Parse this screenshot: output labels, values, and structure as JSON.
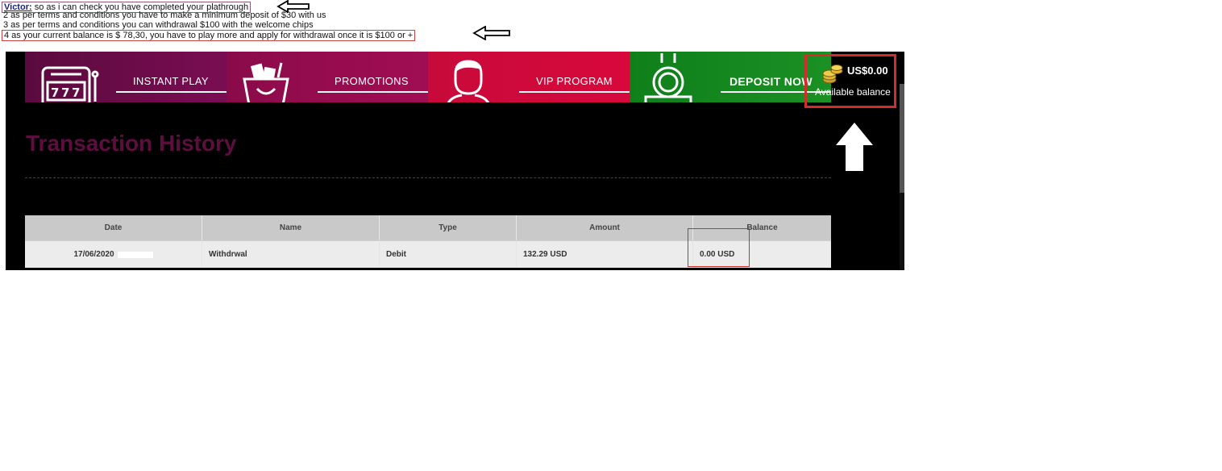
{
  "chat": {
    "speaker": "Victor:",
    "line1": " so as i can check you have completed your plathrough",
    "line2": "2 as per terms and conditions you have to make a minimum deposit of $30 with us",
    "line3": "3 as per terms and conditions you can withdrawal $100 with the welcome chips",
    "line4": "4 as your current balance is $ 78,30, you have to play more and apply for withdrawal once it is $100 or +"
  },
  "nav": {
    "items": [
      {
        "label": "INSTANT PLAY",
        "color": "#6b0b48",
        "icon": "slot-machine-icon"
      },
      {
        "label": "PROMOTIONS",
        "color": "#9a0b4e",
        "icon": "gift-bag-icon"
      },
      {
        "label": "VIP PROGRAM",
        "color": "#d0083a",
        "icon": "person-icon"
      },
      {
        "label": "DEPOSIT NOW",
        "color": "#178a1f",
        "icon": "coin-drop-icon"
      }
    ]
  },
  "balance": {
    "amount": "US$0.00",
    "label": "Available balance",
    "icon": "coins-icon"
  },
  "page": {
    "title": "Transaction History"
  },
  "table": {
    "headers": [
      "Date",
      "Name",
      "Type",
      "Amount",
      "Balance"
    ],
    "rows": [
      {
        "date": "17/06/2020",
        "name": "Withdrwal",
        "type": "Debit",
        "amount": "132.29 USD",
        "balance": "0.00 USD"
      }
    ]
  },
  "colors": {
    "title": "#5c0f3f",
    "highlight_border": "#d12d2d",
    "header_bg": "#c9c9c9",
    "row_bg": "#ececec"
  }
}
